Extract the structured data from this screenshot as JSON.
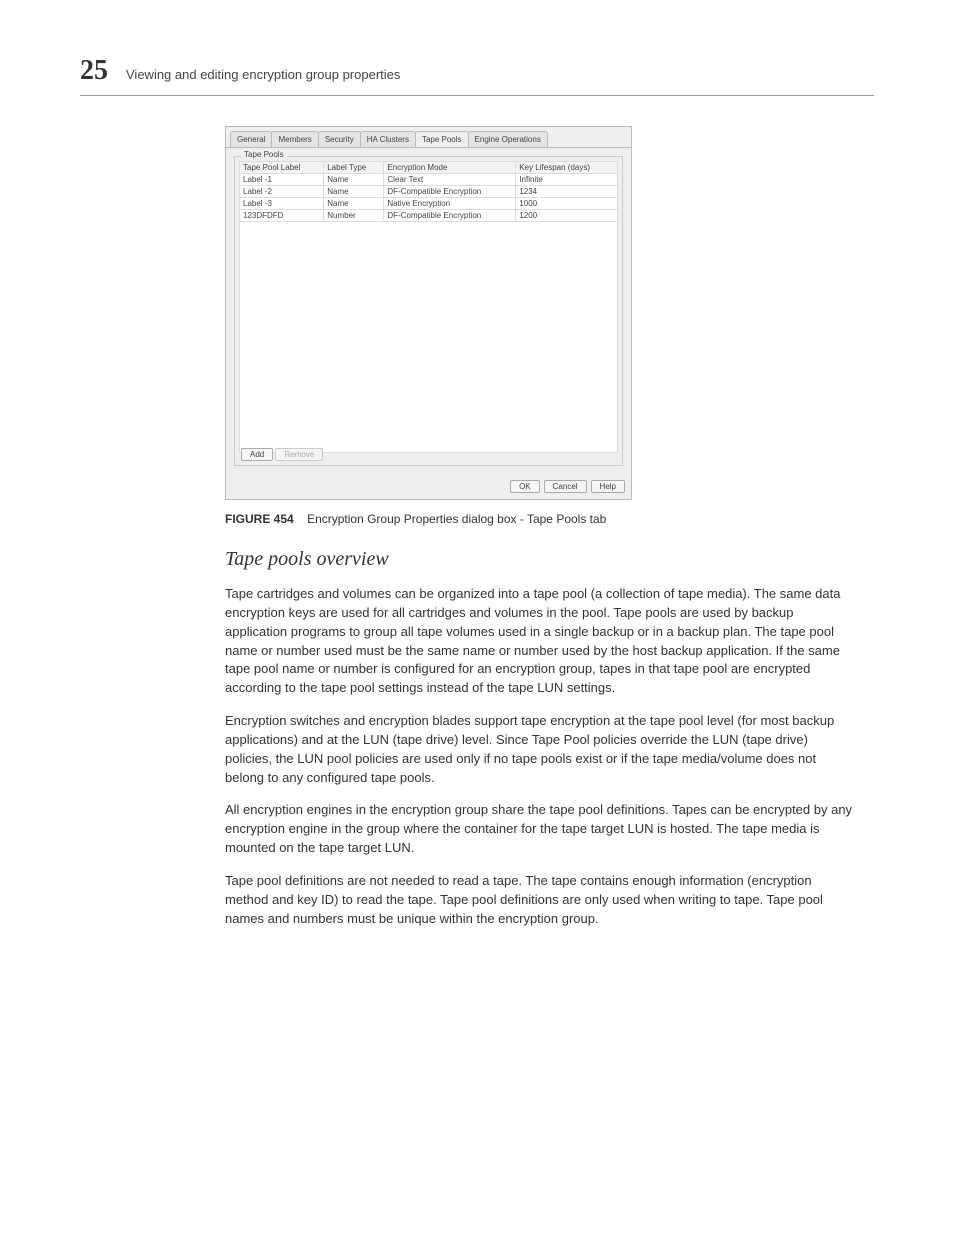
{
  "header": {
    "chapter": "25",
    "title": "Viewing and editing encryption group properties"
  },
  "dialog": {
    "tabs": [
      "General",
      "Members",
      "Security",
      "HA Clusters",
      "Tape Pools",
      "Engine Operations"
    ],
    "active_tab_index": 4,
    "group_label": "Tape Pools",
    "columns": [
      "Tape Pool Label",
      "Label Type",
      "Encryption Mode",
      "Key Lifespan (days)"
    ],
    "rows": [
      {
        "c0": "Label -1",
        "c1": "Name",
        "c2": "Clear Text",
        "c3": "Infinite"
      },
      {
        "c0": "Label -2",
        "c1": "Name",
        "c2": "DF-Compatible Encryption",
        "c3": "1234"
      },
      {
        "c0": "Label -3",
        "c1": "Name",
        "c2": "Native Encryption",
        "c3": "1000"
      },
      {
        "c0": "123DFDFD",
        "c1": "Number",
        "c2": "DF-Compatible Encryption",
        "c3": "1200"
      }
    ],
    "buttons": {
      "add": "Add",
      "remove": "Remove",
      "ok": "OK",
      "cancel": "Cancel",
      "help": "Help"
    }
  },
  "caption": {
    "label": "FIGURE 454",
    "text": "Encryption Group Properties dialog box - Tape Pools tab"
  },
  "overview": {
    "heading": "Tape pools overview",
    "p1": "Tape cartridges and volumes can be organized into a tape pool (a collection of tape media). The same data encryption keys are used for all cartridges and volumes in the pool. Tape pools are used by backup application programs to group all tape volumes used in a single backup or in a backup plan. The tape pool name or number used must be the same name or number used by the host backup application. If the same tape pool name or number is configured for an encryption group, tapes in that tape pool are encrypted according to the tape pool settings instead of the tape LUN settings.",
    "p2": "Encryption switches and encryption blades support tape encryption at the tape pool level (for most backup applications) and at the LUN (tape drive) level. Since Tape Pool policies override the LUN (tape drive) policies, the LUN pool policies are used only if no tape pools exist or if the tape media/volume does not belong to any configured tape pools.",
    "p3": "All encryption engines in the encryption group share the tape pool definitions. Tapes can be encrypted by any encryption engine in the group where the container for the tape target LUN is hosted. The tape media is mounted on the tape target LUN.",
    "p4": "Tape pool definitions are not needed to read a tape. The tape contains enough information (encryption method and key ID) to read the tape. Tape pool definitions are only used when writing to tape. Tape pool names and numbers must be unique within the encryption group."
  }
}
